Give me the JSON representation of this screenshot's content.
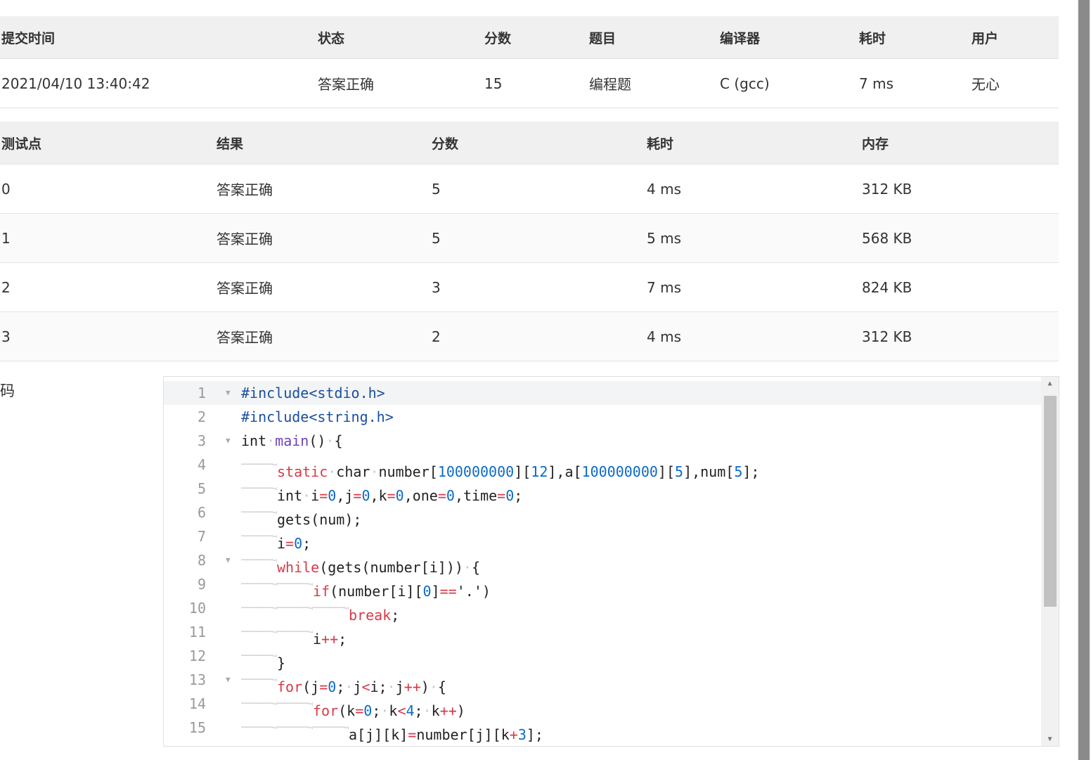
{
  "submission": {
    "headers": [
      "提交时间",
      "状态",
      "分数",
      "题目",
      "编译器",
      "耗时",
      "用户"
    ],
    "row": {
      "time": "2021/04/10 13:40:42",
      "status": "答案正确",
      "score": "15",
      "problem": "编程题",
      "compiler": "C (gcc)",
      "duration": "7 ms",
      "user": "无心"
    }
  },
  "tests": {
    "headers": [
      "测试点",
      "结果",
      "分数",
      "耗时",
      "内存"
    ],
    "rows": [
      {
        "id": "0",
        "result": "答案正确",
        "score": "5",
        "time": "4 ms",
        "memory": "312 KB"
      },
      {
        "id": "1",
        "result": "答案正确",
        "score": "5",
        "time": "5 ms",
        "memory": "568 KB"
      },
      {
        "id": "2",
        "result": "答案正确",
        "score": "3",
        "time": "7 ms",
        "memory": "824 KB"
      },
      {
        "id": "3",
        "result": "答案正确",
        "score": "2",
        "time": "4 ms",
        "memory": "312 KB"
      }
    ]
  },
  "code_label": "码",
  "code_lines": [
    {
      "n": "1",
      "fold": true,
      "tabs": 0,
      "tokens": [
        [
          "pp",
          "#include<stdio.h>"
        ]
      ]
    },
    {
      "n": "2",
      "fold": false,
      "tabs": 0,
      "tokens": [
        [
          "pp",
          "#include<string.h>"
        ]
      ]
    },
    {
      "n": "3",
      "fold": true,
      "tabs": 0,
      "tokens": [
        [
          "",
          "int"
        ],
        [
          "dot",
          "·"
        ],
        [
          "fn",
          "main"
        ],
        [
          "",
          "()"
        ],
        [
          "dot",
          "·"
        ],
        [
          "",
          "{"
        ]
      ]
    },
    {
      "n": "4",
      "fold": false,
      "tabs": 1,
      "tokens": [
        [
          "kw",
          "static"
        ],
        [
          "dot",
          "·"
        ],
        [
          "",
          "char"
        ],
        [
          "dot",
          "·"
        ],
        [
          "",
          "number["
        ],
        [
          "num",
          "100000000"
        ],
        [
          "",
          "]["
        ],
        [
          "num",
          "12"
        ],
        [
          "",
          "],a["
        ],
        [
          "num",
          "100000000"
        ],
        [
          "",
          "]["
        ],
        [
          "num",
          "5"
        ],
        [
          "",
          "],num["
        ],
        [
          "num",
          "5"
        ],
        [
          "",
          "];"
        ]
      ]
    },
    {
      "n": "5",
      "fold": false,
      "tabs": 1,
      "tokens": [
        [
          "",
          "int"
        ],
        [
          "dot",
          "·"
        ],
        [
          "",
          "i"
        ],
        [
          "kw",
          "="
        ],
        [
          "num",
          "0"
        ],
        [
          "",
          ",j"
        ],
        [
          "kw",
          "="
        ],
        [
          "num",
          "0"
        ],
        [
          "",
          ",k"
        ],
        [
          "kw",
          "="
        ],
        [
          "num",
          "0"
        ],
        [
          "",
          ",one"
        ],
        [
          "kw",
          "="
        ],
        [
          "num",
          "0"
        ],
        [
          "",
          ",time"
        ],
        [
          "kw",
          "="
        ],
        [
          "num",
          "0"
        ],
        [
          "",
          ";"
        ]
      ]
    },
    {
      "n": "6",
      "fold": false,
      "tabs": 1,
      "tokens": [
        [
          "",
          "gets(num);"
        ]
      ]
    },
    {
      "n": "7",
      "fold": false,
      "tabs": 1,
      "tokens": [
        [
          "",
          "i"
        ],
        [
          "kw",
          "="
        ],
        [
          "num",
          "0"
        ],
        [
          "",
          ";"
        ]
      ]
    },
    {
      "n": "8",
      "fold": true,
      "tabs": 1,
      "tokens": [
        [
          "kw",
          "while"
        ],
        [
          "",
          "(gets(number[i]))"
        ],
        [
          "dot",
          "·"
        ],
        [
          "",
          "{"
        ]
      ]
    },
    {
      "n": "9",
      "fold": false,
      "tabs": 2,
      "tokens": [
        [
          "kw",
          "if"
        ],
        [
          "",
          "(number[i]["
        ],
        [
          "num",
          "0"
        ],
        [
          "",
          "]"
        ],
        [
          "kw",
          "=="
        ],
        [
          "",
          "'.')"
        ]
      ]
    },
    {
      "n": "10",
      "fold": false,
      "tabs": 3,
      "tokens": [
        [
          "kw",
          "break"
        ],
        [
          "",
          ";"
        ]
      ]
    },
    {
      "n": "11",
      "fold": false,
      "tabs": 2,
      "tokens": [
        [
          "",
          "i"
        ],
        [
          "kw",
          "++"
        ],
        [
          "",
          ";"
        ]
      ]
    },
    {
      "n": "12",
      "fold": false,
      "tabs": 1,
      "tokens": [
        [
          "",
          "}"
        ]
      ]
    },
    {
      "n": "13",
      "fold": true,
      "tabs": 1,
      "tokens": [
        [
          "kw",
          "for"
        ],
        [
          "",
          "(j"
        ],
        [
          "kw",
          "="
        ],
        [
          "num",
          "0"
        ],
        [
          "",
          ";"
        ],
        [
          "dot",
          "·"
        ],
        [
          "",
          "j"
        ],
        [
          "kw",
          "<"
        ],
        [
          "",
          "i;"
        ],
        [
          "dot",
          "·"
        ],
        [
          "",
          "j"
        ],
        [
          "kw",
          "++"
        ],
        [
          "",
          ")"
        ],
        [
          "dot",
          "·"
        ],
        [
          "",
          "{"
        ]
      ]
    },
    {
      "n": "14",
      "fold": false,
      "tabs": 2,
      "tokens": [
        [
          "kw",
          "for"
        ],
        [
          "",
          "(k"
        ],
        [
          "kw",
          "="
        ],
        [
          "num",
          "0"
        ],
        [
          "",
          ";"
        ],
        [
          "dot",
          "·"
        ],
        [
          "",
          "k"
        ],
        [
          "kw",
          "<"
        ],
        [
          "num",
          "4"
        ],
        [
          "",
          ";"
        ],
        [
          "dot",
          "·"
        ],
        [
          "",
          "k"
        ],
        [
          "kw",
          "++"
        ],
        [
          "",
          ")"
        ]
      ]
    },
    {
      "n": "15",
      "fold": false,
      "tabs": 3,
      "tokens": [
        [
          "",
          "a[j][k]"
        ],
        [
          "kw",
          "="
        ],
        [
          "",
          "number[j][k"
        ],
        [
          "kw",
          "+"
        ],
        [
          "num",
          "3"
        ],
        [
          "",
          "];"
        ]
      ]
    }
  ]
}
